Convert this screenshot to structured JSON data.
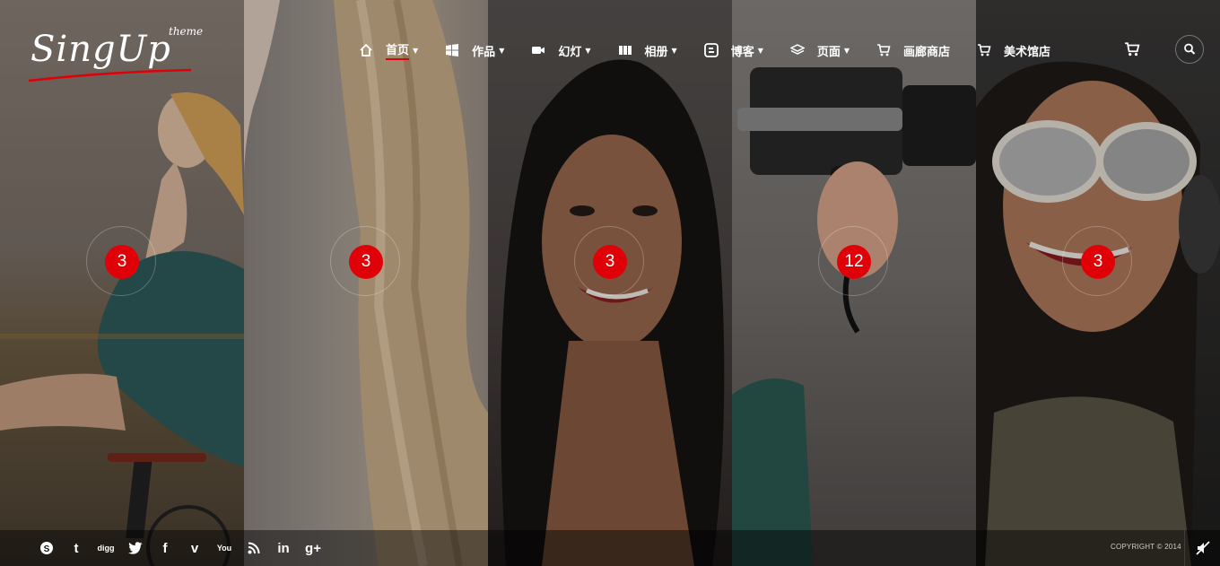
{
  "logo": {
    "name": "SingUp",
    "tag": "theme"
  },
  "nav": {
    "items": [
      {
        "label": "首页",
        "icon": "home-icon",
        "active": true,
        "dropdown": true
      },
      {
        "label": "作品",
        "icon": "windows-icon",
        "dropdown": true
      },
      {
        "label": "幻灯",
        "icon": "video-camera-icon",
        "dropdown": true
      },
      {
        "label": "相册",
        "icon": "gallery-icon",
        "dropdown": true
      },
      {
        "label": "博客",
        "icon": "blogger-icon",
        "dropdown": true
      },
      {
        "label": "页面",
        "icon": "layers-icon",
        "dropdown": true
      },
      {
        "label": "画廊商店",
        "icon": "cart-icon",
        "dropdown": false
      },
      {
        "label": "美术馆店",
        "icon": "cart-icon",
        "dropdown": false
      }
    ]
  },
  "panels": [
    {
      "count": "3"
    },
    {
      "count": "3"
    },
    {
      "count": "3"
    },
    {
      "count": "12"
    },
    {
      "count": "3"
    }
  ],
  "footer": {
    "social": [
      {
        "name": "skype-icon",
        "glyph": "S"
      },
      {
        "name": "tumblr-icon",
        "glyph": "t"
      },
      {
        "name": "digg-icon",
        "glyph": "digg"
      },
      {
        "name": "twitter-icon",
        "glyph": ""
      },
      {
        "name": "facebook-icon",
        "glyph": "f"
      },
      {
        "name": "vimeo-icon",
        "glyph": "v"
      },
      {
        "name": "youtube-icon",
        "glyph": "You"
      },
      {
        "name": "rss-icon",
        "glyph": ""
      },
      {
        "name": "linkedin-icon",
        "glyph": "in"
      },
      {
        "name": "google-plus-icon",
        "glyph": "g+"
      }
    ],
    "copyright": "COPYRIGHT © 2014"
  },
  "colors": {
    "accent": "#e00008"
  }
}
